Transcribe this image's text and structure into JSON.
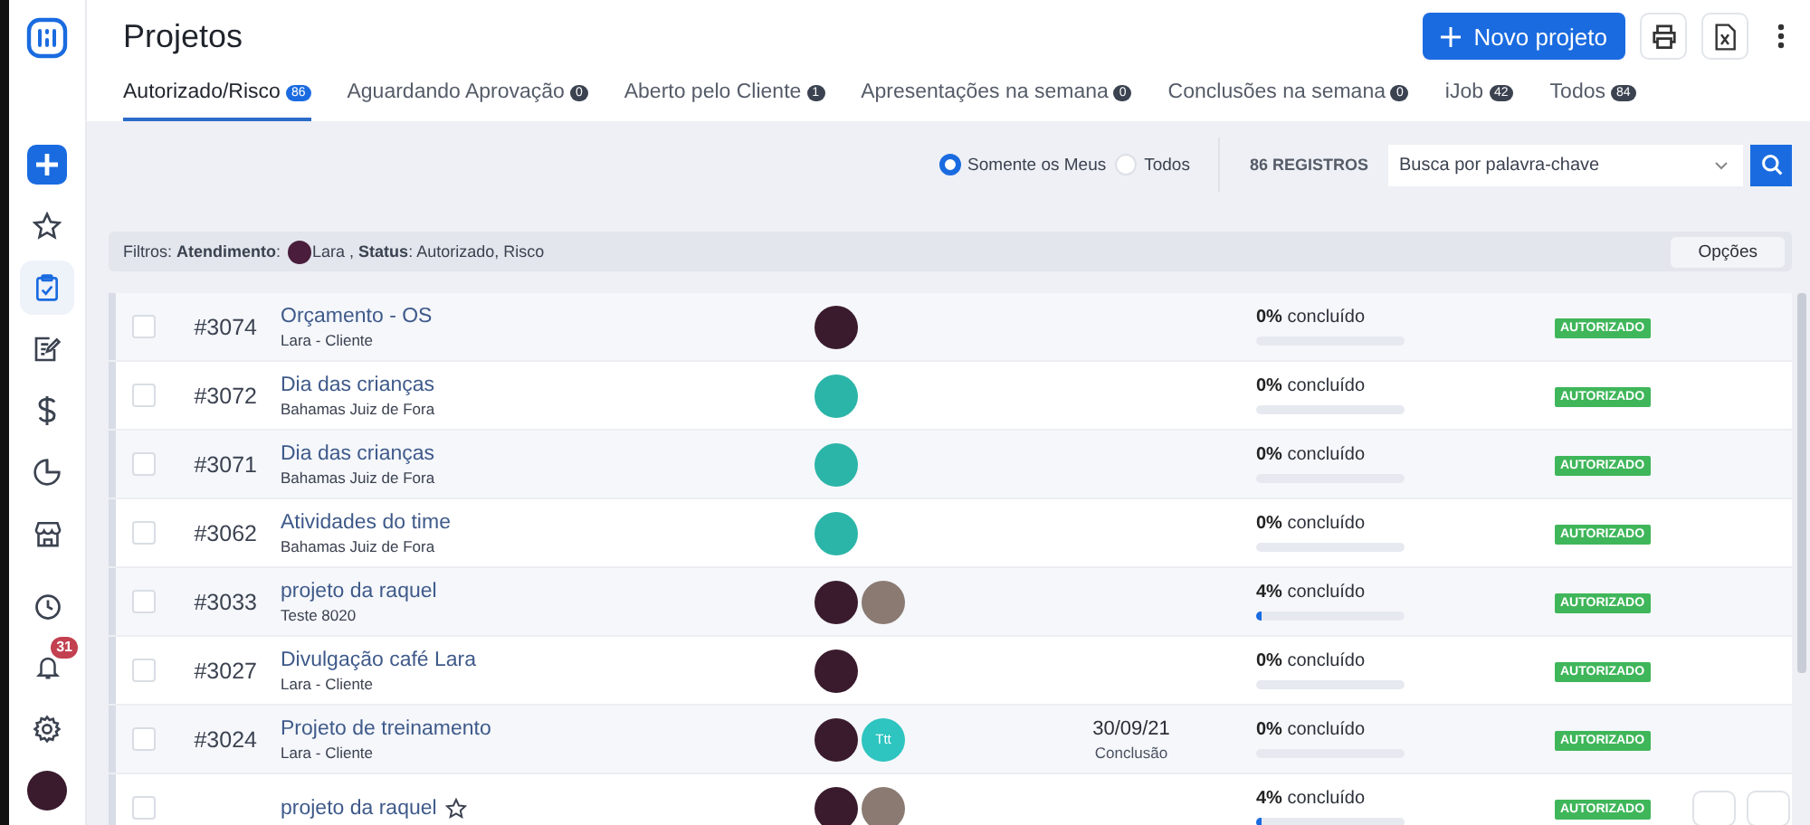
{
  "sidebar": {
    "notification_count": "31",
    "items": [
      {
        "kind": "logo",
        "selected": false
      },
      {
        "kind": "add",
        "selected": false
      },
      {
        "kind": "star",
        "selected": false
      },
      {
        "kind": "clipboard",
        "selected": true
      },
      {
        "kind": "edit",
        "selected": false
      },
      {
        "kind": "dollar",
        "selected": false
      },
      {
        "kind": "pie",
        "selected": false
      },
      {
        "kind": "store",
        "selected": false
      }
    ],
    "bottom_items": [
      {
        "kind": "clock"
      },
      {
        "kind": "bell"
      },
      {
        "kind": "gear"
      },
      {
        "kind": "avatar",
        "color": "#3a1b2e"
      }
    ]
  },
  "header": {
    "title": "Projetos",
    "new_button": "Novo projeto"
  },
  "tabs": [
    {
      "label": "Autorizado/Risco",
      "count": "86",
      "selected": true
    },
    {
      "label": "Aguardando Aprovação",
      "count": "0",
      "selected": false
    },
    {
      "label": "Aberto pelo Cliente",
      "count": "1",
      "selected": false
    },
    {
      "label": "Apresentações na semana",
      "count": "0",
      "selected": false
    },
    {
      "label": "Conclusões na semana",
      "count": "0",
      "selected": false
    },
    {
      "label": "iJob",
      "count": "42",
      "selected": false
    },
    {
      "label": "Todos",
      "count": "84",
      "selected": false
    }
  ],
  "toolbar": {
    "scope_options": [
      {
        "label": "Somente os Meus",
        "selected": true
      },
      {
        "label": "Todos",
        "selected": false
      }
    ],
    "record_count": "86 REGISTROS",
    "search": {
      "placeholder": "Busca por palavra-chave"
    }
  },
  "filter_bar": {
    "prefix": "Filtros: **Atendimento**:",
    "avatar": {
      "color": "#4a1d3c"
    },
    "rest": "Lara , **Status**: Autorizado, Risco",
    "options_button": "Opções"
  },
  "rows": [
    {
      "id": "#3074",
      "title": "Orçamento - OS",
      "client": "Lara - Cliente",
      "checked": false,
      "hovered": false,
      "avatars": [
        {
          "kind": "photo",
          "color": "#3a1b2e"
        }
      ],
      "progress_text": "**0%** concluído",
      "level": 0,
      "status": "AUTORIZADO"
    },
    {
      "id": "#3072",
      "title": "Dia das crianças",
      "client": "Bahamas Juiz de Fora",
      "checked": false,
      "hovered": false,
      "avatars": [
        {
          "kind": "photo",
          "color": "#2bb5a8"
        }
      ],
      "progress_text": "**0%** concluído",
      "level": 0,
      "status": "AUTORIZADO"
    },
    {
      "id": "#3071",
      "title": "Dia das crianças",
      "client": "Bahamas Juiz de Fora",
      "checked": false,
      "hovered": false,
      "avatars": [
        {
          "kind": "photo",
          "color": "#2bb5a8"
        }
      ],
      "progress_text": "**0%** concluído",
      "level": 0,
      "status": "AUTORIZADO"
    },
    {
      "id": "#3062",
      "title": "Atividades do time",
      "client": "Bahamas Juiz de Fora",
      "checked": false,
      "hovered": false,
      "avatars": [
        {
          "kind": "photo",
          "color": "#2bb5a8"
        }
      ],
      "progress_text": "**0%** concluído",
      "level": 0,
      "status": "AUTORIZADO"
    },
    {
      "id": "#3033",
      "title": "projeto da raquel",
      "client": "Teste 8020",
      "checked": false,
      "hovered": false,
      "avatars": [
        {
          "kind": "photo",
          "color": "#3a1b2e"
        },
        {
          "kind": "photo",
          "color": "#8a7a72"
        }
      ],
      "progress_text": "**4%** concluído",
      "level": 0.04,
      "status": "AUTORIZADO"
    },
    {
      "id": "#3027",
      "title": "Divulgação café Lara",
      "client": "Lara - Cliente",
      "checked": false,
      "hovered": false,
      "avatars": [
        {
          "kind": "photo",
          "color": "#3a1b2e"
        }
      ],
      "progress_text": "**0%** concluído",
      "level": 0,
      "status": "AUTORIZADO"
    },
    {
      "id": "#3024",
      "title": "Projeto de treinamento",
      "client": "Lara - Cliente",
      "checked": false,
      "hovered": false,
      "avatars": [
        {
          "kind": "photo",
          "color": "#3a1b2e"
        },
        {
          "kind": "initials",
          "text": "Ttt",
          "color": "#2ec4c0"
        }
      ],
      "date": "30/09/21",
      "date_label": "Conclusão",
      "progress_text": "**0%** concluído",
      "level": 0,
      "status": "AUTORIZADO"
    },
    {
      "title": "projeto da raquel",
      "checked": false,
      "hovered": true,
      "avatars": [
        {
          "kind": "photo",
          "color": "#3a1b2e"
        },
        {
          "kind": "photo",
          "color": "#8a7a72"
        }
      ],
      "progress_text": "**4%** concluído",
      "level": 0.04,
      "status": "AUTORIZADO"
    }
  ]
}
